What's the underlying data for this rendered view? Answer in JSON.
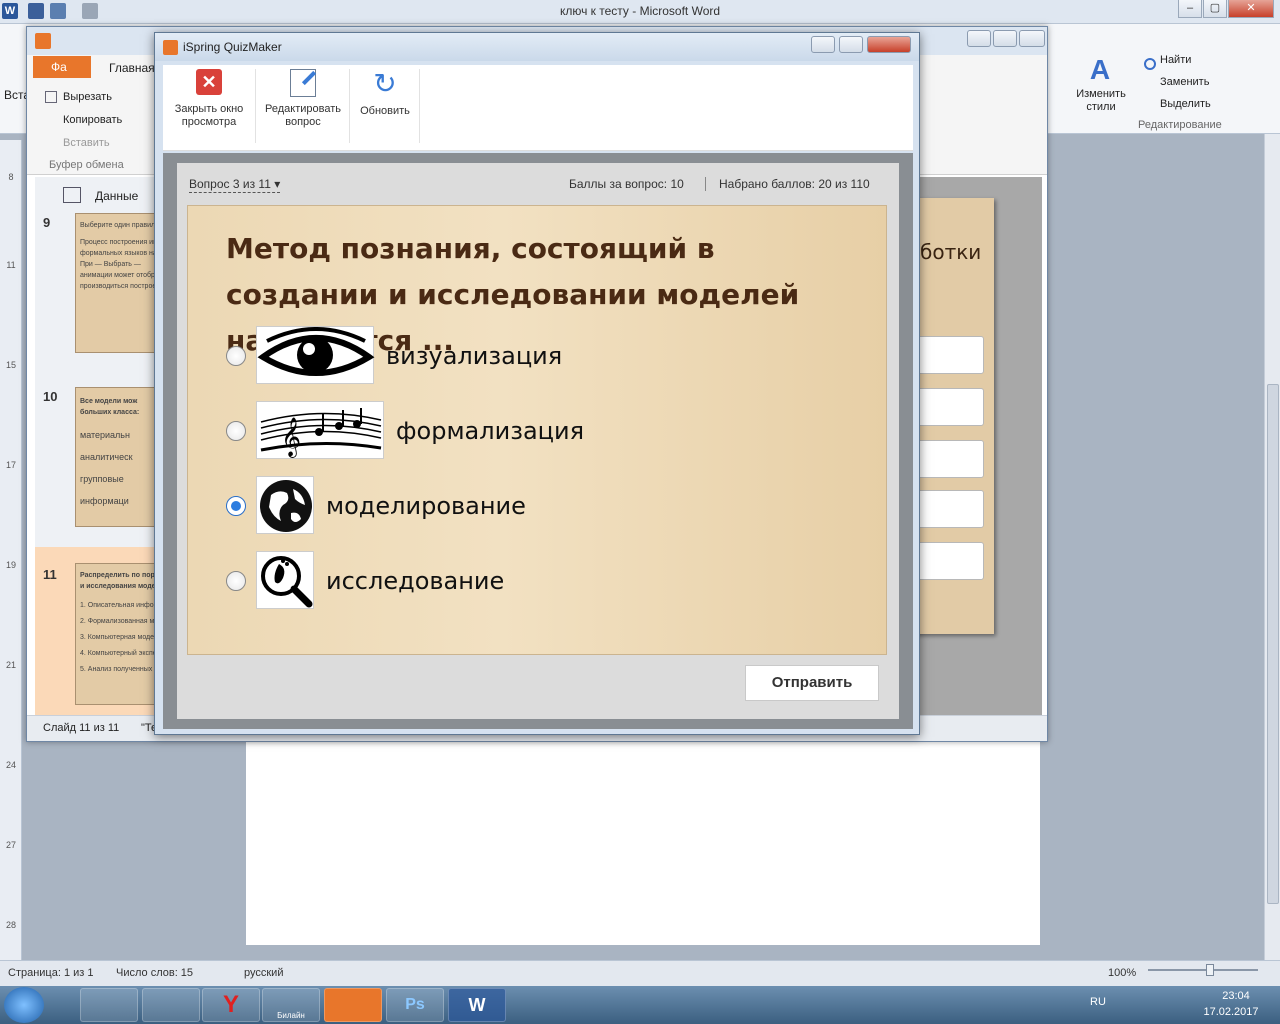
{
  "word": {
    "title": "ключ к тесту  -  Microsoft Word",
    "ribbon": {
      "paste_label": "Вста",
      "styles_label": "Изменить стили",
      "find": "Найти",
      "replace": "Заменить",
      "select": "Выделить",
      "editing_group": "Редактирование"
    },
    "status": {
      "page": "Страница: 1 из 1",
      "words": "Число слов: 15",
      "lang": "русский",
      "zoom": "100%"
    }
  },
  "editor": {
    "tab_file": "Фа",
    "tab_home": "Главная",
    "cut": "Вырезать",
    "copy": "Копировать",
    "paste": "Вставить",
    "clipboard_group": "Буфер обмена",
    "data_label": "Данные",
    "slide_count": "Слайд 11 из 11",
    "status_extra": "\"Те",
    "slide_text_fragment": "ботки",
    "thumbnails": [
      {
        "num": "9",
        "lines": [
          "Выберите один правильн",
          "Процесс построения инфо",
          "формальных языков назы",
          "При  — Выбрать —",
          "анимации может отображ",
          "производиться построени"
        ]
      },
      {
        "num": "10",
        "lines": [
          "Все модели мож",
          "больших класса:",
          "материальн",
          "аналитическ",
          "групповые",
          "информаци"
        ]
      },
      {
        "num": "11",
        "lines": [
          "Распределить по пор",
          "и исследования моде",
          "1.  Описательная инфор",
          "2.  Формализованная мо",
          "3.  Компьютерная моде",
          "4.  Компьютерный экспе",
          "5.  Анализ полученных р"
        ]
      }
    ]
  },
  "quiz": {
    "window_title": "iSpring QuizMaker",
    "toolbar": {
      "close_preview": "Закрыть окно просмотра",
      "edit_question": "Редактировать вопрос",
      "refresh": "Обновить"
    },
    "question_nav": "Вопрос 3 из 11",
    "points_per_question": "Баллы за вопрос: 10",
    "score": "Набрано баллов: 20 из 110",
    "question_text": "Метод познания, состоящий в создании и исследовании моделей называется ...",
    "options": [
      {
        "label": "визуализация",
        "icon": "eye-icon",
        "selected": false
      },
      {
        "label": "формализация",
        "icon": "music-notes-icon",
        "selected": false
      },
      {
        "label": "моделирование",
        "icon": "globe-icon",
        "selected": true
      },
      {
        "label": "исследование",
        "icon": "magnifier-footprint-icon",
        "selected": false
      }
    ],
    "submit": "Отправить"
  },
  "taskbar": {
    "lang": "RU",
    "time": "23:04",
    "date": "17.02.2017",
    "beeline_label": "Билайн"
  }
}
